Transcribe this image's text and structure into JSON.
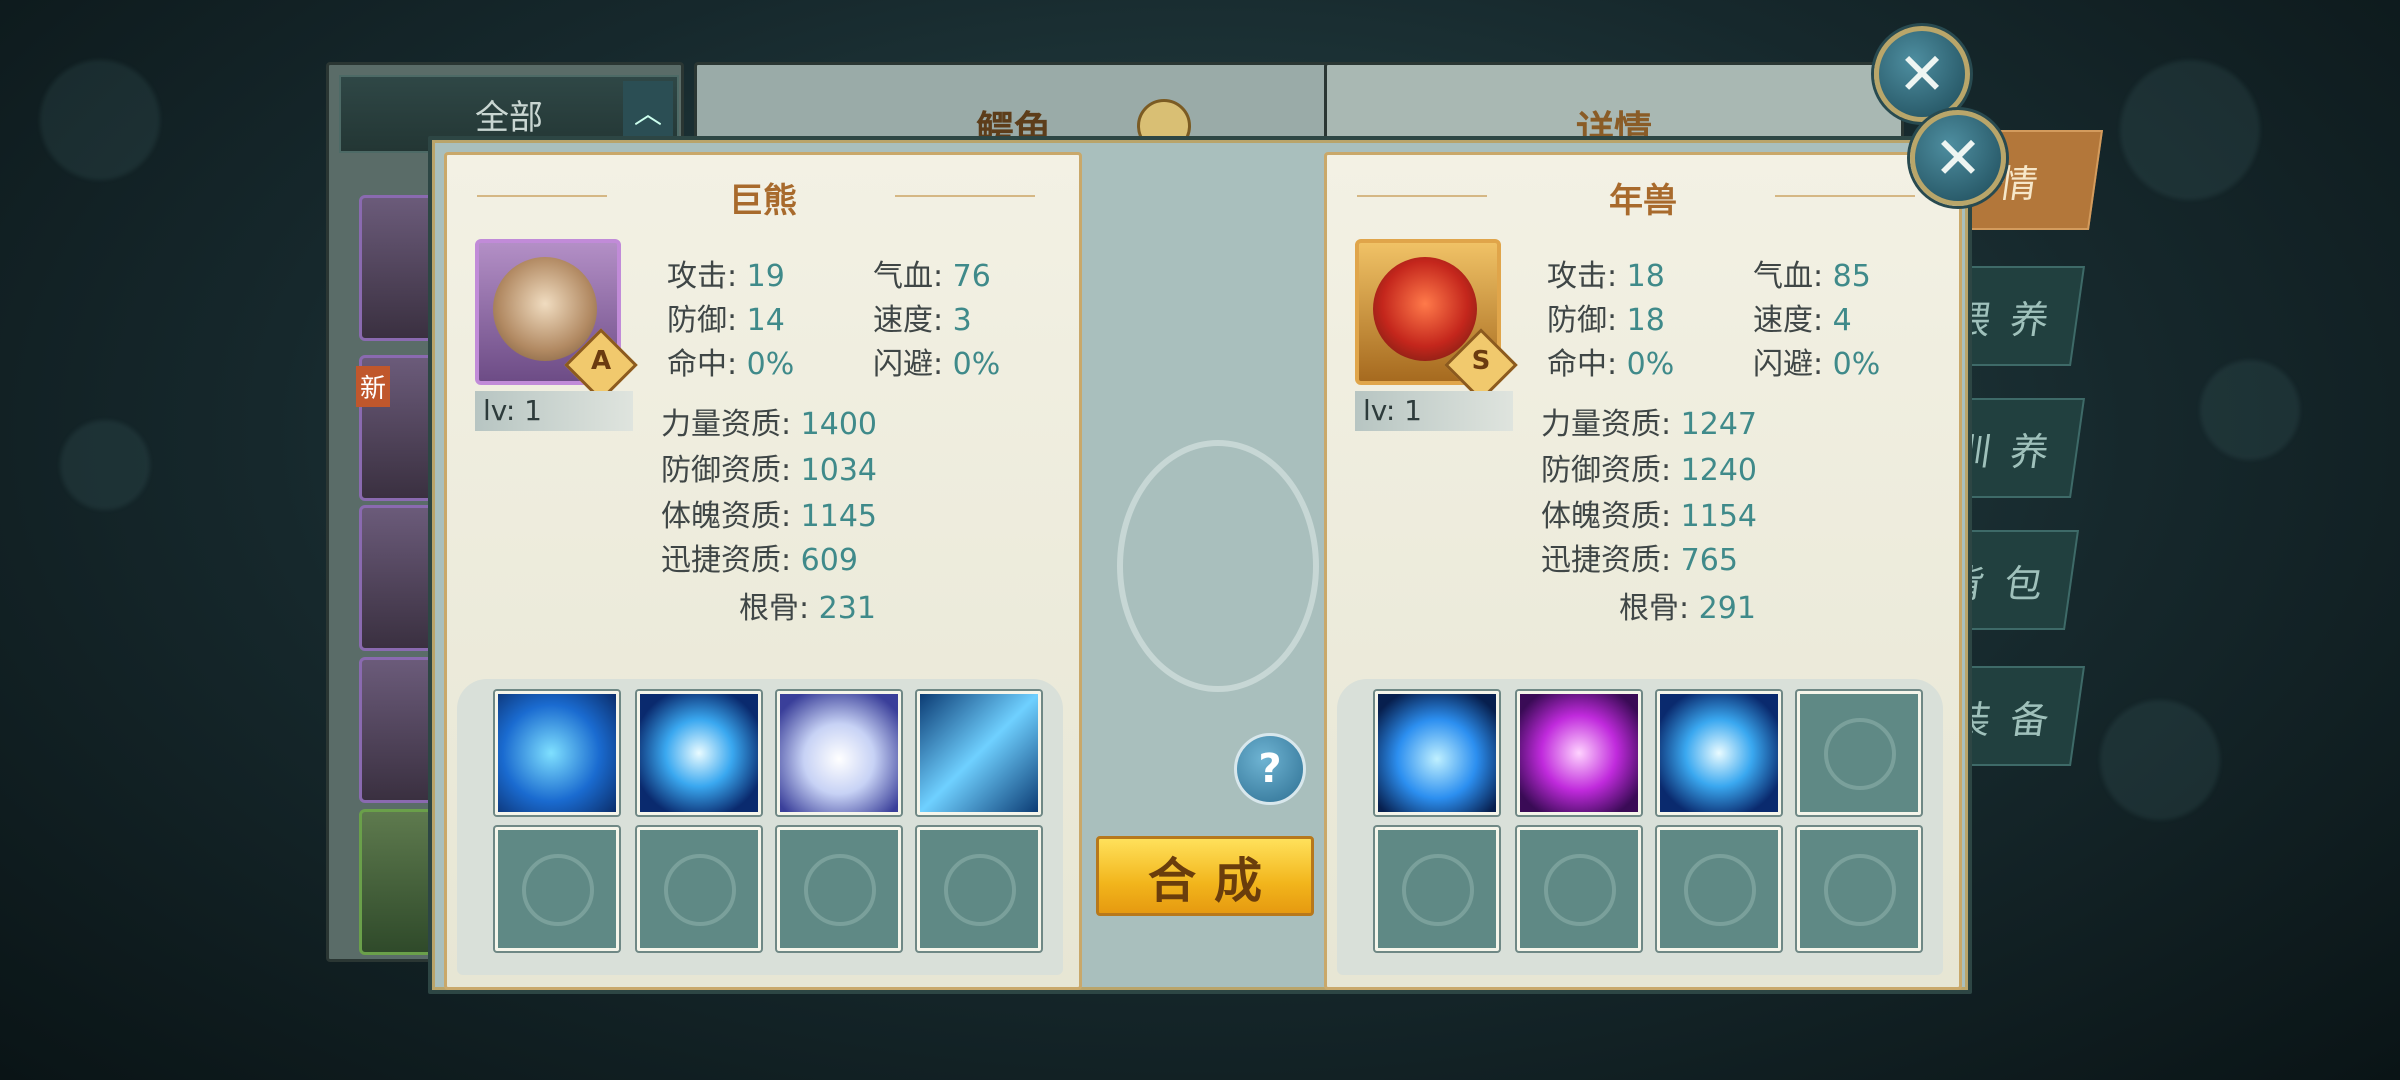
{
  "background_window": {
    "filter_label": "全部",
    "title": "鳄龟",
    "detail_title": "详情",
    "new_badge": "新",
    "side_tabs": [
      "情",
      "喂养",
      "训养",
      "背包",
      "装备"
    ]
  },
  "left_pet": {
    "name": "巨熊",
    "grade": "A",
    "level": "lv: 1",
    "stats": {
      "attack_label": "攻击:",
      "attack": "19",
      "hp_label": "气血:",
      "hp": "76",
      "defense_label": "防御:",
      "defense": "14",
      "speed_label": "速度:",
      "speed": "3",
      "hit_label": "命中:",
      "hit": "0%",
      "dodge_label": "闪避:",
      "dodge": "0%"
    },
    "aptitudes": {
      "strength_label": "力量资质:",
      "strength": "1400",
      "defense_label": "防御资质:",
      "defense": "1034",
      "body_label": "体魄资质:",
      "body": "1145",
      "agility_label": "迅捷资质:",
      "agility": "609",
      "root_label": "根骨:",
      "root": "231"
    },
    "skill_icons": [
      "blue-beast-skill-icon",
      "blue-vortex-skill-icon",
      "white-orb-skill-icon",
      "lightning-skill-icon"
    ]
  },
  "right_pet": {
    "name": "年兽",
    "grade": "S",
    "level": "lv: 1",
    "stats": {
      "attack_label": "攻击:",
      "attack": "18",
      "hp_label": "气血:",
      "hp": "85",
      "defense_label": "防御:",
      "defense": "18",
      "speed_label": "速度:",
      "speed": "4",
      "hit_label": "命中:",
      "hit": "0%",
      "dodge_label": "闪避:",
      "dodge": "0%"
    },
    "aptitudes": {
      "strength_label": "力量资质:",
      "strength": "1247",
      "defense_label": "防御资质:",
      "defense": "1240",
      "body_label": "体魄资质:",
      "body": "1154",
      "agility_label": "迅捷资质:",
      "agility": "765",
      "root_label": "根骨:",
      "root": "291"
    },
    "skill_icons": [
      "blue-heart-skill-icon",
      "purple-slash-skill-icon",
      "blue-vortex-skill-icon"
    ]
  },
  "actions": {
    "help": "?",
    "synthesize": "合成",
    "close": "✕"
  },
  "colors": {
    "accent_gold": "#f2b51c",
    "name_brown": "#a86a2c",
    "value_teal": "#3f8a8a"
  }
}
